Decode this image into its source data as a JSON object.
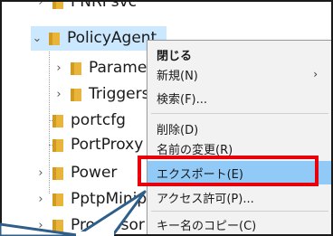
{
  "tree": {
    "items": [
      {
        "label": "PNRPsvc",
        "expander": "›",
        "state": "collapsed"
      },
      {
        "label": "PolicyAgent",
        "expander": "⌄",
        "state": "expanded-selected"
      },
      {
        "label": "Parameters",
        "expander": "›",
        "state": "collapsed"
      },
      {
        "label": "Triggers",
        "expander": "›",
        "state": "collapsed"
      },
      {
        "label": "portcfg",
        "expander": "",
        "state": "leaf"
      },
      {
        "label": "PortProxy",
        "expander": "",
        "state": "leaf"
      },
      {
        "label": "Power",
        "expander": "›",
        "state": "collapsed"
      },
      {
        "label": "PptpMiniport",
        "expander": "›",
        "state": "collapsed"
      },
      {
        "label": "Processor",
        "expander": "›",
        "state": "collapsed"
      }
    ]
  },
  "context_menu": {
    "items": [
      {
        "label": "閉じる",
        "bold": true
      },
      {
        "label": "新規(N)",
        "submenu": "›"
      },
      {
        "label": "検索(F)..."
      },
      {
        "label": "削除(D)"
      },
      {
        "label": "名前の変更(R)"
      },
      {
        "label": "エクスポート(E)",
        "highlighted": true
      },
      {
        "label": "アクセス許可(P)..."
      },
      {
        "label": "キー名のコピー(C)"
      }
    ]
  },
  "annotation": {
    "highlight_color": "#e8000b",
    "callout_color": "#2e5f8a",
    "menu_highlight_color": "#91c9f7",
    "selection_color": "#cce8ff",
    "folder_color": "#e8b53a"
  }
}
